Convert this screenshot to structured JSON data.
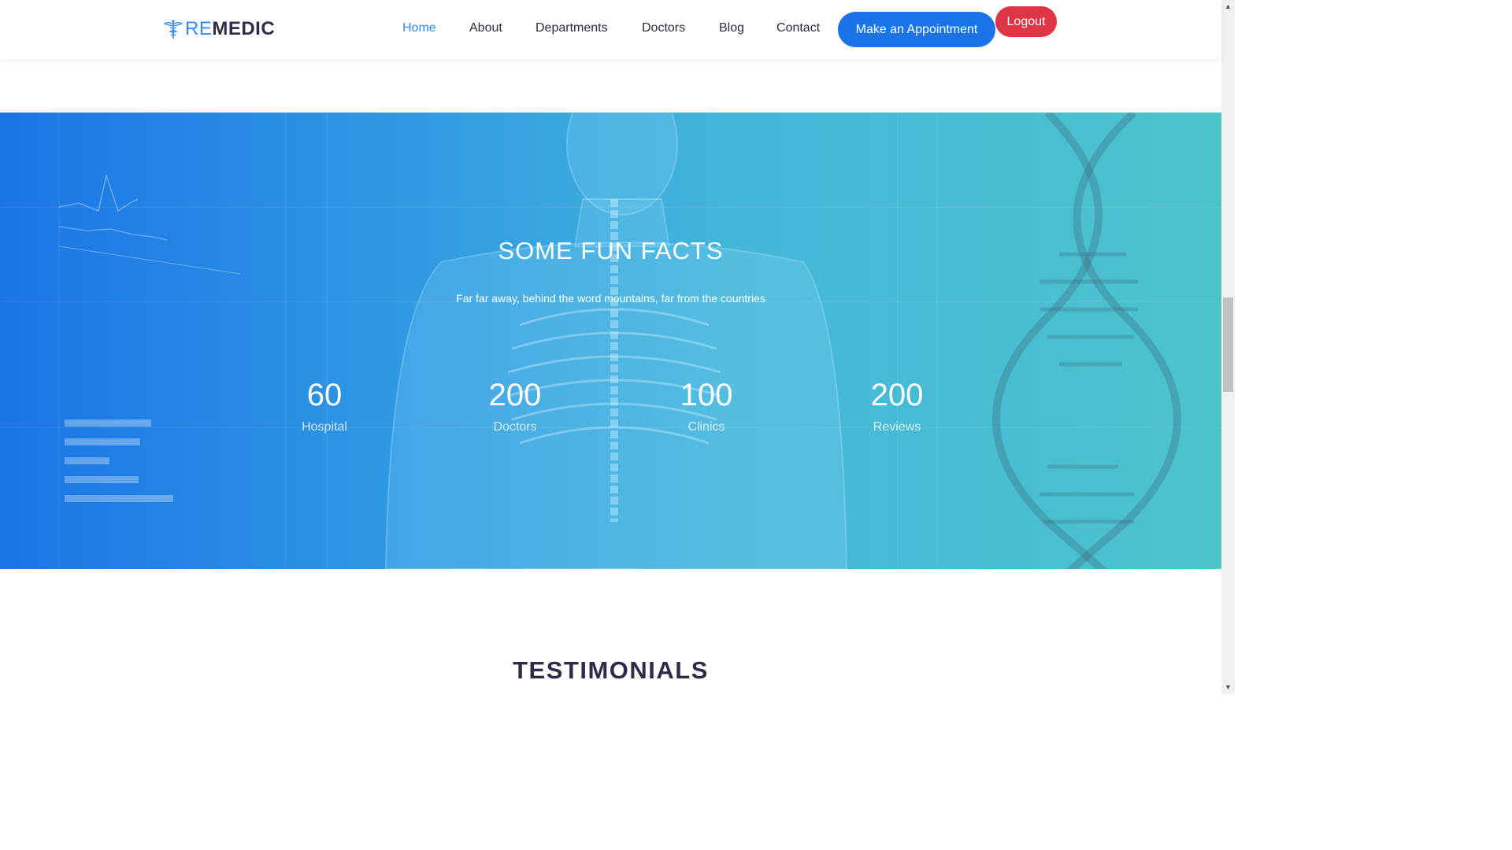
{
  "header": {
    "logo_prefix": "RE",
    "logo_suffix": "MEDIC",
    "nav": [
      {
        "label": "Home",
        "active": true
      },
      {
        "label": "About",
        "active": false
      },
      {
        "label": "Departments",
        "active": false
      },
      {
        "label": "Doctors",
        "active": false
      },
      {
        "label": "Blog",
        "active": false
      },
      {
        "label": "Contact",
        "active": false
      }
    ],
    "appointment_label": "Make an Appointment",
    "logout_label": "Logout"
  },
  "facts": {
    "title": "SOME FUN FACTS",
    "subtitle": "Far far away, behind the word mountains, far from the countries",
    "stats": [
      {
        "value": "60",
        "label": "Hospital"
      },
      {
        "value": "200",
        "label": "Doctors"
      },
      {
        "value": "100",
        "label": "Clinics"
      },
      {
        "value": "200",
        "label": "Reviews"
      }
    ]
  },
  "testimonials": {
    "title": "TESTIMONIALS"
  },
  "colors": {
    "primary": "#1a73e8",
    "accent": "#2f89fc",
    "logout": "#dc3545",
    "dark_text": "#2d2d4a"
  },
  "icons": {
    "logo": "caduceus-icon",
    "scroll_up": "triangle-up-icon",
    "scroll_down": "triangle-down-icon"
  }
}
